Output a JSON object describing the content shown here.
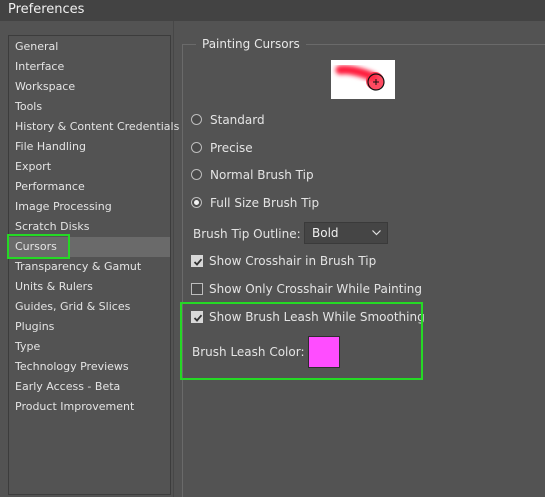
{
  "window": {
    "title": "Preferences"
  },
  "sidebar": {
    "items": [
      {
        "label": "General"
      },
      {
        "label": "Interface"
      },
      {
        "label": "Workspace"
      },
      {
        "label": "Tools"
      },
      {
        "label": "History & Content Credentials"
      },
      {
        "label": "File Handling"
      },
      {
        "label": "Export"
      },
      {
        "label": "Performance"
      },
      {
        "label": "Image Processing"
      },
      {
        "label": "Scratch Disks"
      },
      {
        "label": "Cursors",
        "selected": true
      },
      {
        "label": "Transparency & Gamut"
      },
      {
        "label": "Units & Rulers"
      },
      {
        "label": "Guides, Grid & Slices"
      },
      {
        "label": "Plugins"
      },
      {
        "label": "Type"
      },
      {
        "label": "Technology Previews"
      },
      {
        "label": "Early Access - Beta"
      },
      {
        "label": "Product Improvement"
      }
    ]
  },
  "painting_cursors": {
    "title": "Painting Cursors",
    "options": {
      "standard": "Standard",
      "precise": "Precise",
      "normal_brush_tip": "Normal Brush Tip",
      "full_size_brush_tip": "Full Size Brush Tip"
    },
    "selected_option": "Full Size Brush Tip",
    "brush_tip_outline": {
      "label": "Brush Tip Outline:",
      "value": "Bold"
    },
    "show_crosshair": {
      "label": "Show Crosshair in Brush Tip",
      "checked": true
    },
    "show_only_crosshair": {
      "label": "Show Only Crosshair While Painting",
      "checked": false
    },
    "show_brush_leash": {
      "label": "Show Brush Leash While Smoothing",
      "checked": true
    },
    "brush_leash_color": {
      "label": "Brush Leash Color:",
      "color": "#ff4dff"
    }
  },
  "colors": {
    "highlight": "#25d925"
  }
}
